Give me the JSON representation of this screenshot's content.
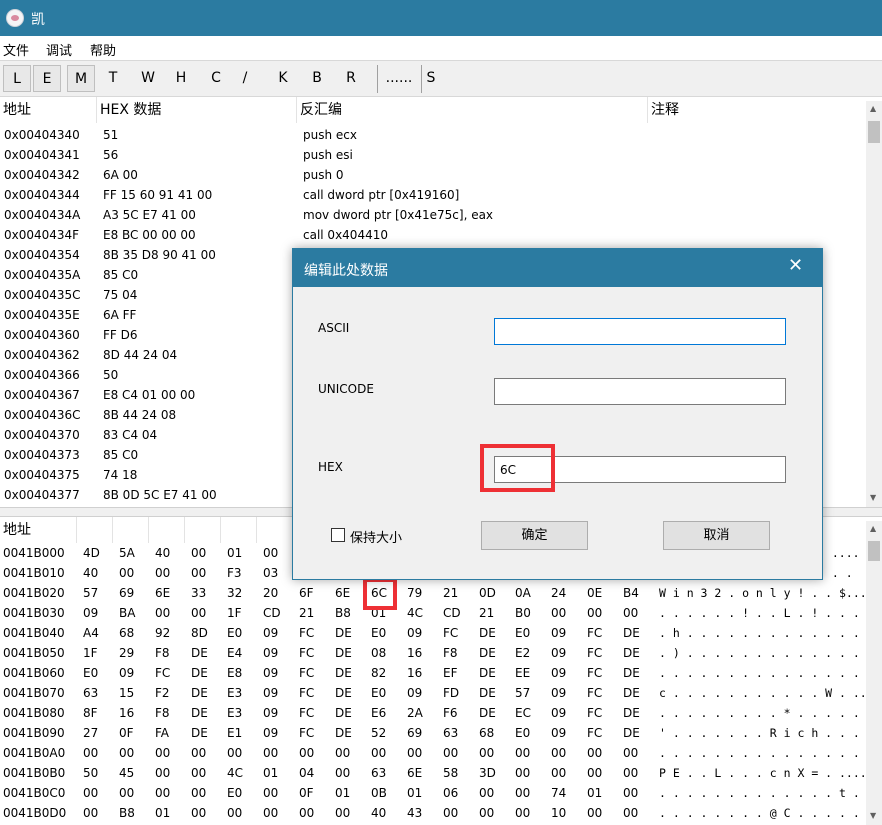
{
  "window": {
    "title": "凯"
  },
  "menu": [
    "文件",
    "调试",
    "帮助"
  ],
  "toolbar": {
    "buttons": [
      "L",
      "E",
      "M",
      "T",
      "W",
      "H",
      "C",
      "/",
      "K",
      "B",
      "R",
      "......",
      "S"
    ]
  },
  "disasm": {
    "headers": {
      "address": "地址",
      "hex": "HEX 数据",
      "disasm": "反汇编",
      "comment": "注释"
    },
    "rows": [
      {
        "addr": "0x00404340",
        "hex": "51",
        "asm": "push ecx"
      },
      {
        "addr": "0x00404341",
        "hex": "56",
        "asm": "push esi"
      },
      {
        "addr": "0x00404342",
        "hex": "6A 00",
        "asm": "push 0"
      },
      {
        "addr": "0x00404344",
        "hex": "FF 15 60 91 41 00",
        "asm": "call dword ptr [0x419160]"
      },
      {
        "addr": "0x0040434A",
        "hex": "A3 5C E7 41 00",
        "asm": "mov dword ptr [0x41e75c], eax"
      },
      {
        "addr": "0x0040434F",
        "hex": "E8 BC 00 00 00",
        "asm": "call 0x404410"
      },
      {
        "addr": "0x00404354",
        "hex": "8B 35 D8 90 41 00",
        "asm": ""
      },
      {
        "addr": "0x0040435A",
        "hex": "85 C0",
        "asm": ""
      },
      {
        "addr": "0x0040435C",
        "hex": "75 04",
        "asm": ""
      },
      {
        "addr": "0x0040435E",
        "hex": "6A FF",
        "asm": ""
      },
      {
        "addr": "0x00404360",
        "hex": "FF D6",
        "asm": ""
      },
      {
        "addr": "0x00404362",
        "hex": "8D 44 24 04",
        "asm": ""
      },
      {
        "addr": "0x00404366",
        "hex": "50",
        "asm": ""
      },
      {
        "addr": "0x00404367",
        "hex": "E8 C4 01 00 00",
        "asm": ""
      },
      {
        "addr": "0x0040436C",
        "hex": "8B 44 24 08",
        "asm": ""
      },
      {
        "addr": "0x00404370",
        "hex": "83 C4 04",
        "asm": ""
      },
      {
        "addr": "0x00404373",
        "hex": "85 C0",
        "asm": ""
      },
      {
        "addr": "0x00404375",
        "hex": "74 18",
        "asm": ""
      },
      {
        "addr": "0x00404377",
        "hex": "8B 0D 5C E7 41 00",
        "asm": ""
      }
    ]
  },
  "dump": {
    "header": "地址",
    "rows": [
      {
        "addr": "0041B000",
        "bytes": [
          "4D",
          "5A",
          "40",
          "00",
          "01",
          "00",
          "",
          "",
          "",
          "",
          "",
          "",
          "",
          "",
          "",
          "",
          ""
        ],
        "ascii": ". ...."
      },
      {
        "addr": "0041B010",
        "bytes": [
          "40",
          "00",
          "00",
          "00",
          "F3",
          "03",
          "",
          "",
          "",
          "",
          "",
          "",
          "",
          "",
          "",
          "",
          ""
        ],
        "ascii": ". . ."
      },
      {
        "addr": "0041B020",
        "bytes": [
          "57",
          "69",
          "6E",
          "33",
          "32",
          "20",
          "6F",
          "6E",
          "6C",
          "79",
          "21",
          "0D",
          "0A",
          "24",
          "0E",
          "B4"
        ],
        "ascii": "W i n 3 2 . o n l y ! . . $..."
      },
      {
        "addr": "0041B030",
        "bytes": [
          "09",
          "BA",
          "00",
          "00",
          "1F",
          "CD",
          "21",
          "B8",
          "01",
          "4C",
          "CD",
          "21",
          "B0",
          "00",
          "00",
          "00"
        ],
        "ascii": ". . . . . . ! . . L . ! . . . ."
      },
      {
        "addr": "0041B040",
        "bytes": [
          "A4",
          "68",
          "92",
          "8D",
          "E0",
          "09",
          "FC",
          "DE",
          "E0",
          "09",
          "FC",
          "DE",
          "E0",
          "09",
          "FC",
          "DE"
        ],
        "ascii": ". h . . . . . . . . . . . . . ."
      },
      {
        "addr": "0041B050",
        "bytes": [
          "1F",
          "29",
          "F8",
          "DE",
          "E4",
          "09",
          "FC",
          "DE",
          "08",
          "16",
          "F8",
          "DE",
          "E2",
          "09",
          "FC",
          "DE"
        ],
        "ascii": ". ) . . . . . . . . . . . . . ."
      },
      {
        "addr": "0041B060",
        "bytes": [
          "E0",
          "09",
          "FC",
          "DE",
          "E8",
          "09",
          "FC",
          "DE",
          "82",
          "16",
          "EF",
          "DE",
          "EE",
          "09",
          "FC",
          "DE"
        ],
        "ascii": ". . . . . . . . . . . . . . . ."
      },
      {
        "addr": "0041B070",
        "bytes": [
          "63",
          "15",
          "F2",
          "DE",
          "E3",
          "09",
          "FC",
          "DE",
          "E0",
          "09",
          "FD",
          "DE",
          "57",
          "09",
          "FC",
          "DE"
        ],
        "ascii": "c . . . . . . . . . . . W . ...."
      },
      {
        "addr": "0041B080",
        "bytes": [
          "8F",
          "16",
          "F8",
          "DE",
          "E3",
          "09",
          "FC",
          "DE",
          "E6",
          "2A",
          "F6",
          "DE",
          "EC",
          "09",
          "FC",
          "DE"
        ],
        "ascii": ". . . . . . . . . * . . . . . ."
      },
      {
        "addr": "0041B090",
        "bytes": [
          "27",
          "0F",
          "FA",
          "DE",
          "E1",
          "09",
          "FC",
          "DE",
          "52",
          "69",
          "63",
          "68",
          "E0",
          "09",
          "FC",
          "DE"
        ],
        "ascii": "' . . . . . . . R i c h . . . ."
      },
      {
        "addr": "0041B0A0",
        "bytes": [
          "00",
          "00",
          "00",
          "00",
          "00",
          "00",
          "00",
          "00",
          "00",
          "00",
          "00",
          "00",
          "00",
          "00",
          "00",
          "00"
        ],
        "ascii": ". . . . . . . . . . . . . . . ."
      },
      {
        "addr": "0041B0B0",
        "bytes": [
          "50",
          "45",
          "00",
          "00",
          "4C",
          "01",
          "04",
          "00",
          "63",
          "6E",
          "58",
          "3D",
          "00",
          "00",
          "00",
          "00"
        ],
        "ascii": "P E . . L . . . c n X = . ...."
      },
      {
        "addr": "0041B0C0",
        "bytes": [
          "00",
          "00",
          "00",
          "00",
          "E0",
          "00",
          "0F",
          "01",
          "0B",
          "01",
          "06",
          "00",
          "00",
          "74",
          "01",
          "00"
        ],
        "ascii": ". . . . . . . . . . . . . t . ."
      },
      {
        "addr": "0041B0D0",
        "bytes": [
          "00",
          "B8",
          "01",
          "00",
          "00",
          "00",
          "00",
          "00",
          "40",
          "43",
          "00",
          "00",
          "00",
          "10",
          "00",
          "00"
        ],
        "ascii": ". . . . . . . . @ C . . . . . ."
      }
    ]
  },
  "dialog": {
    "title": "编辑此处数据",
    "close": "✕",
    "ascii_label": "ASCII",
    "ascii_value": "",
    "unicode_label": "UNICODE",
    "unicode_value": "",
    "hex_label": "HEX",
    "hex_value": "6C",
    "checkbox_label": "保持大小",
    "ok_label": "确定",
    "cancel_label": "取消"
  },
  "colors": {
    "titlebar": "#2b7ba1",
    "highlight": "#ee3035",
    "focus": "#0078d7"
  }
}
